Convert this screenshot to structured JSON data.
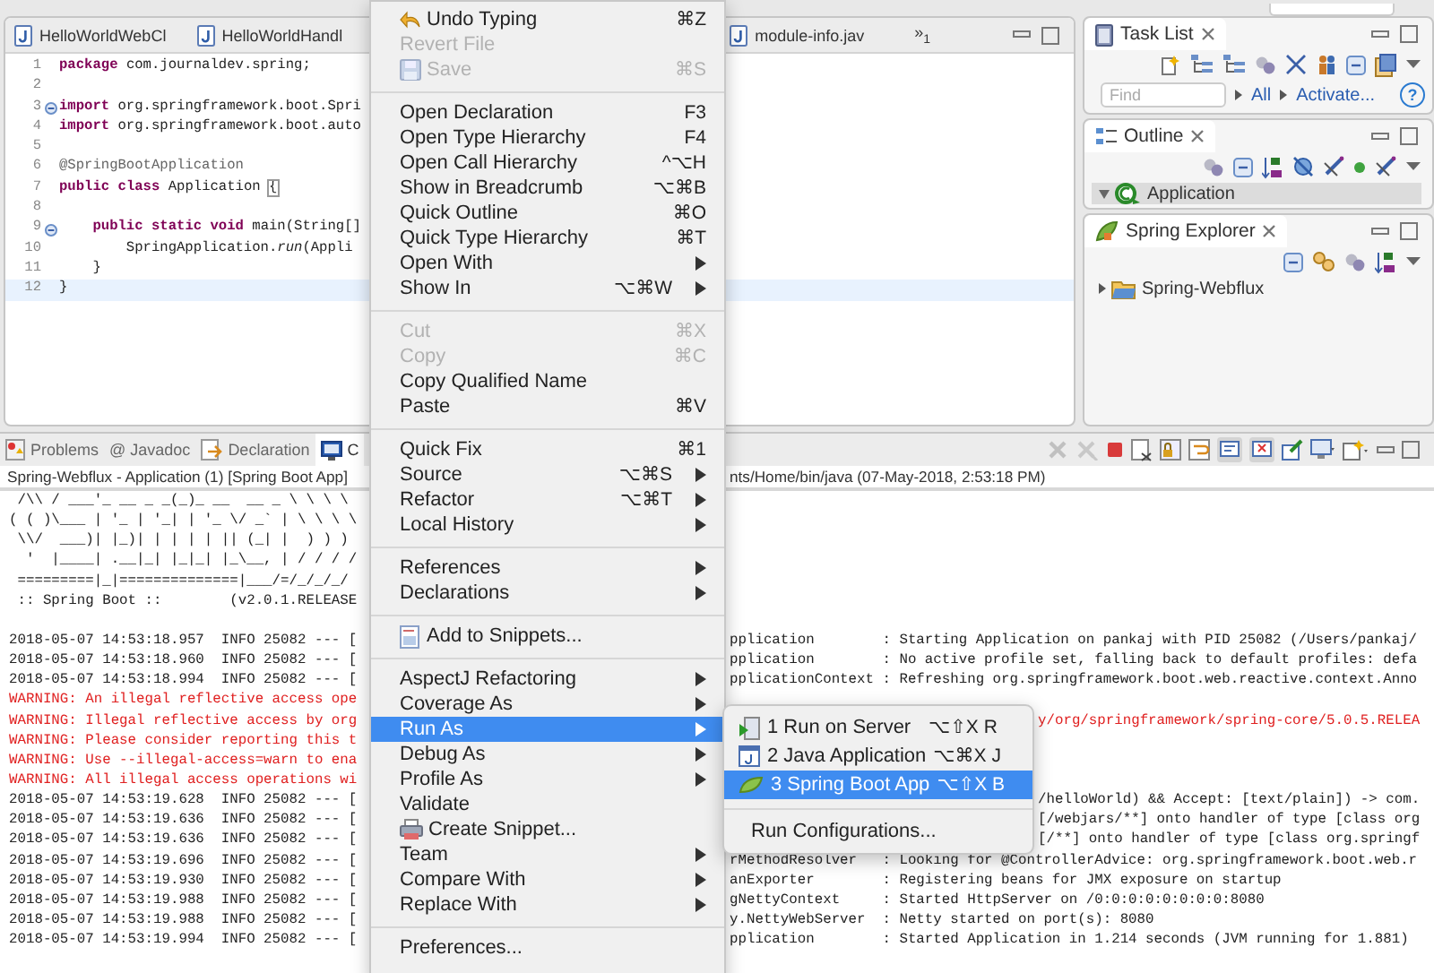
{
  "editor": {
    "tabs": [
      {
        "label": "HelloWorldWebCl",
        "selected": false
      },
      {
        "label": "HelloWorldHandl",
        "selected": false
      },
      {
        "label": "module-info.jav",
        "selected": false
      }
    ],
    "overflow": {
      "glyph": "»",
      "count": "1"
    },
    "lines": [
      {
        "number": "1",
        "kind": "code",
        "foldable": false,
        "current": false,
        "text": "**package** com.journaldev.spring;"
      },
      {
        "number": "2",
        "kind": "blank",
        "foldable": false,
        "current": false
      },
      {
        "number": "3",
        "kind": "code",
        "foldable": true,
        "current": false,
        "text": "**import** org.springframework.boot.Spri"
      },
      {
        "number": "4",
        "kind": "code",
        "foldable": false,
        "current": false,
        "text": "**import** org.springframework.boot.auto"
      },
      {
        "number": "5",
        "kind": "blank",
        "foldable": false,
        "current": false
      },
      {
        "number": "6",
        "kind": "annotation",
        "foldable": false,
        "current": false,
        "text": "@SpringBootApplication"
      },
      {
        "number": "7",
        "kind": "code",
        "foldable": false,
        "current": false,
        "text": "**public** **class** Application ",
        "bracket": "{"
      },
      {
        "number": "8",
        "kind": "blank",
        "foldable": false,
        "current": false
      },
      {
        "number": "9",
        "kind": "code",
        "foldable": true,
        "current": false,
        "text": "    **public** **static** **void** main(String[]"
      },
      {
        "number": "10",
        "kind": "code",
        "foldable": false,
        "current": false,
        "text": "        SpringApplication.*run*(Appli"
      },
      {
        "number": "11",
        "kind": "code",
        "foldable": false,
        "current": false,
        "text": "    }"
      },
      {
        "number": "12",
        "kind": "code",
        "foldable": false,
        "current": true,
        "text": "}"
      }
    ]
  },
  "task_list": {
    "title": "Task List",
    "find_placeholder": "Find",
    "links": [
      "All",
      "Activate..."
    ],
    "help": "?"
  },
  "outline": {
    "title": "Outline",
    "tree": [
      {
        "label": "Application",
        "expanded": true,
        "selected": true
      }
    ]
  },
  "spring_explorer": {
    "title": "Spring Explorer",
    "tree": [
      {
        "label": "Spring-Webflux",
        "expanded": false,
        "selected": false
      }
    ]
  },
  "bottom_panel": {
    "tabs": [
      {
        "label": "Problems",
        "selected": false
      },
      {
        "label": "Javadoc",
        "prefix": "@",
        "selected": false
      },
      {
        "label": "Declaration",
        "selected": false
      },
      {
        "label": "C",
        "selected": true
      }
    ]
  },
  "console": {
    "title_left": "Spring-Webflux - Application (1) [Spring Boot App]",
    "title_right": "nts/Home/bin/java (07-May-2018, 2:53:18 PM)",
    "lines": [
      {
        "kind": "banner",
        "left": " /\\\\ / ___'_ __ _ _(_)_ __  __ _ \\ \\ \\ \\"
      },
      {
        "kind": "banner",
        "left": "( ( )\\___ | '_ | '_| | '_ \\/ _` | \\ \\ \\ \\"
      },
      {
        "kind": "banner",
        "left": " \\\\/  ___)| |_)| | | | | || (_| |  ) ) )"
      },
      {
        "kind": "banner",
        "left": "  '  |____| .__|_| |_|_| |_\\__, | / / / /"
      },
      {
        "kind": "banner",
        "left": " =========|_|==============|___/=/_/_/_/"
      },
      {
        "kind": "banner",
        "left": " :: Spring Boot ::        (v2.0.1.RELEASE"
      },
      {
        "kind": "blank"
      },
      {
        "kind": "info",
        "partly_covered": false,
        "left": "2018-05-07 14:53:18.957  INFO 25082 --- [",
        "right": "pplication        : Starting Application on pankaj with PID 25082 (/Users/pankaj/"
      },
      {
        "kind": "info",
        "partly_covered": false,
        "left": "2018-05-07 14:53:18.960  INFO 25082 --- [",
        "right": "pplication        : No active profile set, falling back to default profiles: defa"
      },
      {
        "kind": "info",
        "partly_covered": false,
        "left": "2018-05-07 14:53:18.994  INFO 25082 --- [",
        "right": "pplicationContext : Refreshing org.springframework.boot.web.reactive.context.Anno"
      },
      {
        "kind": "warning",
        "left": "WARNING: An illegal reflective access ope"
      },
      {
        "kind": "warning",
        "partly_covered": true,
        "left": "WARNING: Illegal reflective access by org",
        "right": "y/org/springframework/spring-core/5.0.5.RELEA"
      },
      {
        "kind": "warning",
        "left": "WARNING: Please consider reporting this t"
      },
      {
        "kind": "warning",
        "left": "WARNING: Use --illegal-access=warn to ena"
      },
      {
        "kind": "warning",
        "left": "WARNING: All illegal access operations wi"
      },
      {
        "kind": "info",
        "partly_covered": true,
        "left": "2018-05-07 14:53:19.628  INFO 25082 --- [",
        "right": "/helloWorld) && Accept: [text/plain]) -> com."
      },
      {
        "kind": "info",
        "partly_covered": true,
        "left": "2018-05-07 14:53:19.636  INFO 25082 --- [",
        "right": "[/webjars/**] onto handler of type [class org"
      },
      {
        "kind": "info",
        "partly_covered": true,
        "left": "2018-05-07 14:53:19.636  INFO 25082 --- [",
        "right": "[/**] onto handler of type [class org.springf"
      },
      {
        "kind": "info",
        "partly_covered": false,
        "left": "2018-05-07 14:53:19.696  INFO 25082 --- [",
        "right": "rMethodResolver   : Looking for @ControllerAdvice: org.springframework.boot.web.r"
      },
      {
        "kind": "info",
        "partly_covered": false,
        "left": "2018-05-07 14:53:19.930  INFO 25082 --- [",
        "right": "anExporter        : Registering beans for JMX exposure on startup"
      },
      {
        "kind": "info",
        "partly_covered": false,
        "left": "2018-05-07 14:53:19.988  INFO 25082 --- [",
        "right": "gNettyContext     : Started HttpServer on /0:0:0:0:0:0:0:0:8080"
      },
      {
        "kind": "info",
        "partly_covered": false,
        "left": "2018-05-07 14:53:19.988  INFO 25082 --- [",
        "right": "y.NettyWebServer  : Netty started on port(s): 8080"
      },
      {
        "kind": "info",
        "partly_covered": false,
        "left": "2018-05-07 14:53:19.994  INFO 25082 --- [",
        "right": "pplication        : Started Application in 1.214 seconds (JVM running for 1.881)"
      }
    ]
  },
  "context_menu": {
    "groups": [
      [
        {
          "label": "Undo Typing",
          "shortcut": "⌘Z",
          "submenu": false,
          "disabled": false,
          "selected": false
        },
        {
          "label": "Revert File",
          "submenu": false,
          "disabled": true,
          "selected": false
        },
        {
          "label": "Save",
          "shortcut": "⌘S",
          "submenu": false,
          "disabled": true,
          "selected": false
        }
      ],
      [
        {
          "label": "Open Declaration",
          "shortcut": "F3",
          "submenu": false,
          "disabled": false,
          "selected": false
        },
        {
          "label": "Open Type Hierarchy",
          "shortcut": "F4",
          "submenu": false,
          "disabled": false,
          "selected": false
        },
        {
          "label": "Open Call Hierarchy",
          "shortcut": "^⌥H",
          "submenu": false,
          "disabled": false,
          "selected": false
        },
        {
          "label": "Show in Breadcrumb",
          "shortcut": "⌥⌘B",
          "submenu": false,
          "disabled": false,
          "selected": false
        },
        {
          "label": "Quick Outline",
          "shortcut": "⌘O",
          "submenu": false,
          "disabled": false,
          "selected": false
        },
        {
          "label": "Quick Type Hierarchy",
          "shortcut": "⌘T",
          "submenu": false,
          "disabled": false,
          "selected": false
        },
        {
          "label": "Open With",
          "submenu": true,
          "disabled": false,
          "selected": false
        },
        {
          "label": "Show In",
          "shortcut": "⌥⌘W",
          "submenu": true,
          "disabled": false,
          "selected": false
        }
      ],
      [
        {
          "label": "Cut",
          "shortcut": "⌘X",
          "submenu": false,
          "disabled": true,
          "selected": false
        },
        {
          "label": "Copy",
          "shortcut": "⌘C",
          "submenu": false,
          "disabled": true,
          "selected": false
        },
        {
          "label": "Copy Qualified Name",
          "submenu": false,
          "disabled": false,
          "selected": false
        },
        {
          "label": "Paste",
          "shortcut": "⌘V",
          "submenu": false,
          "disabled": false,
          "selected": false
        }
      ],
      [
        {
          "label": "Quick Fix",
          "shortcut": "⌘1",
          "submenu": false,
          "disabled": false,
          "selected": false
        },
        {
          "label": "Source",
          "shortcut": "⌥⌘S",
          "submenu": true,
          "disabled": false,
          "selected": false
        },
        {
          "label": "Refactor",
          "shortcut": "⌥⌘T",
          "submenu": true,
          "disabled": false,
          "selected": false
        },
        {
          "label": "Local History",
          "submenu": true,
          "disabled": false,
          "selected": false
        }
      ],
      [
        {
          "label": "References",
          "submenu": true,
          "disabled": false,
          "selected": false
        },
        {
          "label": "Declarations",
          "submenu": true,
          "disabled": false,
          "selected": false
        }
      ],
      [
        {
          "label": "Add to Snippets...",
          "submenu": false,
          "disabled": false,
          "selected": false
        }
      ],
      [
        {
          "label": "AspectJ Refactoring",
          "submenu": true,
          "disabled": false,
          "selected": false
        },
        {
          "label": "Coverage As",
          "submenu": true,
          "disabled": false,
          "selected": false
        },
        {
          "label": "Run As",
          "submenu": true,
          "disabled": false,
          "selected": true
        },
        {
          "label": "Debug As",
          "submenu": true,
          "disabled": false,
          "selected": false
        },
        {
          "label": "Profile As",
          "submenu": true,
          "disabled": false,
          "selected": false
        },
        {
          "label": "Validate",
          "submenu": false,
          "disabled": false,
          "selected": false
        },
        {
          "label": "Create Snippet...",
          "submenu": false,
          "disabled": false,
          "selected": false
        },
        {
          "label": "Team",
          "submenu": true,
          "disabled": false,
          "selected": false
        },
        {
          "label": "Compare With",
          "submenu": true,
          "disabled": false,
          "selected": false
        },
        {
          "label": "Replace With",
          "submenu": true,
          "disabled": false,
          "selected": false
        }
      ],
      [
        {
          "label": "Preferences...",
          "submenu": false,
          "disabled": false,
          "selected": false
        }
      ]
    ]
  },
  "run_as_menu": {
    "groups": [
      [
        {
          "label": "1 Run on Server",
          "shortcut": "⌥⇧X R",
          "selected": false
        },
        {
          "label": "2 Java Application",
          "shortcut": "⌥⌘X J",
          "selected": false
        },
        {
          "label": "3 Spring Boot App",
          "shortcut": "⌥⇧X B",
          "selected": true
        }
      ],
      [
        {
          "label": "Run Configurations...",
          "selected": false
        }
      ]
    ]
  }
}
